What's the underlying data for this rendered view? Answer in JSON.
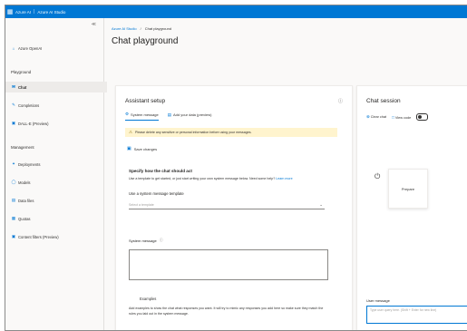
{
  "topbar": {
    "waffle_icon": "waffle-grid",
    "product": "Azure AI",
    "separator": "|",
    "studio": "Azure AI Studio"
  },
  "sidebar": {
    "items_top": [
      {
        "label": "Azure OpenAI",
        "icon": "home-icon"
      }
    ],
    "playground_heading": "Playground",
    "playground_items": [
      {
        "label": "Chat",
        "icon": "chat-icon",
        "active": true
      },
      {
        "label": "Completions",
        "icon": "completions-icon"
      },
      {
        "label": "DALL-E (Preview)",
        "icon": "image-icon"
      }
    ],
    "management_heading": "Management",
    "management_items": [
      {
        "label": "Deployments",
        "icon": "deploy-icon"
      },
      {
        "label": "Models",
        "icon": "models-icon"
      },
      {
        "label": "Data files",
        "icon": "files-icon"
      },
      {
        "label": "Quotas",
        "icon": "quota-icon"
      },
      {
        "label": "Content filters (Preview)",
        "icon": "filter-icon"
      }
    ]
  },
  "breadcrumb": {
    "home": "Azure AI Studio",
    "sep": "/",
    "current": "Chat playground"
  },
  "page_title": "Chat playground",
  "assistant_setup": {
    "title": "Assistant setup",
    "tabs": [
      {
        "label": "System message",
        "active": true
      },
      {
        "label": "Add your data (preview)"
      }
    ],
    "banner": "Please delete any sensitive or personal information before using your messages.",
    "save_label": "Save changes",
    "specify_heading": "Specify how the chat should act",
    "specify_body": "Use a template to get started, or just start writing your own system message below. Need some help?",
    "learn_more": "Learn more",
    "template_label": "Use a system message template",
    "template_placeholder": "Select a template",
    "system_message_label": "System message",
    "system_message_value": "",
    "examples_label": "Examples",
    "examples_body": "Add examples to show the chat what responses you want. It will try to mimic any responses you add here so make sure they match the rules you laid out in the system message."
  },
  "chat_session": {
    "title": "Chat session",
    "tools": {
      "clear_chat": "Clear chat",
      "view_code": "View code",
      "raw_json_toggle": "off"
    },
    "bubble_text": "Prepare",
    "user_message_label": "User message",
    "user_message_placeholder": "Type user query here. (Shift + Enter for new line)"
  }
}
